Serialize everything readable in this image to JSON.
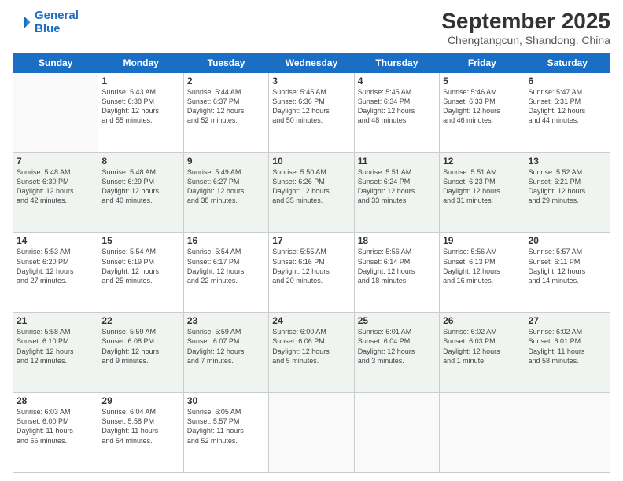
{
  "logo": {
    "line1": "General",
    "line2": "Blue"
  },
  "title": "September 2025",
  "subtitle": "Chengtangcun, Shandong, China",
  "weekdays": [
    "Sunday",
    "Monday",
    "Tuesday",
    "Wednesday",
    "Thursday",
    "Friday",
    "Saturday"
  ],
  "weeks": [
    [
      {
        "num": "",
        "info": ""
      },
      {
        "num": "1",
        "info": "Sunrise: 5:43 AM\nSunset: 6:38 PM\nDaylight: 12 hours\nand 55 minutes."
      },
      {
        "num": "2",
        "info": "Sunrise: 5:44 AM\nSunset: 6:37 PM\nDaylight: 12 hours\nand 52 minutes."
      },
      {
        "num": "3",
        "info": "Sunrise: 5:45 AM\nSunset: 6:36 PM\nDaylight: 12 hours\nand 50 minutes."
      },
      {
        "num": "4",
        "info": "Sunrise: 5:45 AM\nSunset: 6:34 PM\nDaylight: 12 hours\nand 48 minutes."
      },
      {
        "num": "5",
        "info": "Sunrise: 5:46 AM\nSunset: 6:33 PM\nDaylight: 12 hours\nand 46 minutes."
      },
      {
        "num": "6",
        "info": "Sunrise: 5:47 AM\nSunset: 6:31 PM\nDaylight: 12 hours\nand 44 minutes."
      }
    ],
    [
      {
        "num": "7",
        "info": "Sunrise: 5:48 AM\nSunset: 6:30 PM\nDaylight: 12 hours\nand 42 minutes."
      },
      {
        "num": "8",
        "info": "Sunrise: 5:48 AM\nSunset: 6:29 PM\nDaylight: 12 hours\nand 40 minutes."
      },
      {
        "num": "9",
        "info": "Sunrise: 5:49 AM\nSunset: 6:27 PM\nDaylight: 12 hours\nand 38 minutes."
      },
      {
        "num": "10",
        "info": "Sunrise: 5:50 AM\nSunset: 6:26 PM\nDaylight: 12 hours\nand 35 minutes."
      },
      {
        "num": "11",
        "info": "Sunrise: 5:51 AM\nSunset: 6:24 PM\nDaylight: 12 hours\nand 33 minutes."
      },
      {
        "num": "12",
        "info": "Sunrise: 5:51 AM\nSunset: 6:23 PM\nDaylight: 12 hours\nand 31 minutes."
      },
      {
        "num": "13",
        "info": "Sunrise: 5:52 AM\nSunset: 6:21 PM\nDaylight: 12 hours\nand 29 minutes."
      }
    ],
    [
      {
        "num": "14",
        "info": "Sunrise: 5:53 AM\nSunset: 6:20 PM\nDaylight: 12 hours\nand 27 minutes."
      },
      {
        "num": "15",
        "info": "Sunrise: 5:54 AM\nSunset: 6:19 PM\nDaylight: 12 hours\nand 25 minutes."
      },
      {
        "num": "16",
        "info": "Sunrise: 5:54 AM\nSunset: 6:17 PM\nDaylight: 12 hours\nand 22 minutes."
      },
      {
        "num": "17",
        "info": "Sunrise: 5:55 AM\nSunset: 6:16 PM\nDaylight: 12 hours\nand 20 minutes."
      },
      {
        "num": "18",
        "info": "Sunrise: 5:56 AM\nSunset: 6:14 PM\nDaylight: 12 hours\nand 18 minutes."
      },
      {
        "num": "19",
        "info": "Sunrise: 5:56 AM\nSunset: 6:13 PM\nDaylight: 12 hours\nand 16 minutes."
      },
      {
        "num": "20",
        "info": "Sunrise: 5:57 AM\nSunset: 6:11 PM\nDaylight: 12 hours\nand 14 minutes."
      }
    ],
    [
      {
        "num": "21",
        "info": "Sunrise: 5:58 AM\nSunset: 6:10 PM\nDaylight: 12 hours\nand 12 minutes."
      },
      {
        "num": "22",
        "info": "Sunrise: 5:59 AM\nSunset: 6:08 PM\nDaylight: 12 hours\nand 9 minutes."
      },
      {
        "num": "23",
        "info": "Sunrise: 5:59 AM\nSunset: 6:07 PM\nDaylight: 12 hours\nand 7 minutes."
      },
      {
        "num": "24",
        "info": "Sunrise: 6:00 AM\nSunset: 6:06 PM\nDaylight: 12 hours\nand 5 minutes."
      },
      {
        "num": "25",
        "info": "Sunrise: 6:01 AM\nSunset: 6:04 PM\nDaylight: 12 hours\nand 3 minutes."
      },
      {
        "num": "26",
        "info": "Sunrise: 6:02 AM\nSunset: 6:03 PM\nDaylight: 12 hours\nand 1 minute."
      },
      {
        "num": "27",
        "info": "Sunrise: 6:02 AM\nSunset: 6:01 PM\nDaylight: 11 hours\nand 58 minutes."
      }
    ],
    [
      {
        "num": "28",
        "info": "Sunrise: 6:03 AM\nSunset: 6:00 PM\nDaylight: 11 hours\nand 56 minutes."
      },
      {
        "num": "29",
        "info": "Sunrise: 6:04 AM\nSunset: 5:58 PM\nDaylight: 11 hours\nand 54 minutes."
      },
      {
        "num": "30",
        "info": "Sunrise: 6:05 AM\nSunset: 5:57 PM\nDaylight: 11 hours\nand 52 minutes."
      },
      {
        "num": "",
        "info": ""
      },
      {
        "num": "",
        "info": ""
      },
      {
        "num": "",
        "info": ""
      },
      {
        "num": "",
        "info": ""
      }
    ]
  ]
}
